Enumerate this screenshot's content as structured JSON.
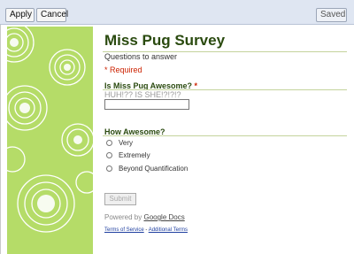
{
  "toolbar": {
    "apply_label": "Apply",
    "cancel_label": "Cancel",
    "saved_label": "Saved"
  },
  "form": {
    "title": "Miss Pug Survey",
    "subtitle": "Questions to answer",
    "required_note": "* Required",
    "questions": [
      {
        "title": "Is Miss Pug Awesome?",
        "required_mark": "*",
        "help_text": "HUH!?? IS SHE!?!?!?",
        "value": ""
      },
      {
        "title": "How Awesome?",
        "options": [
          "Very",
          "Extremely",
          "Beyond Quantification"
        ]
      }
    ],
    "submit_label": "Submit"
  },
  "footer": {
    "powered_prefix": "Powered by",
    "powered_link": "Google Docs",
    "terms_label": "Terms of Service",
    "separator": " - ",
    "additional_terms_label": "Additional Terms"
  },
  "theme": {
    "accent_green": "#b5dc68",
    "title_color": "#2a4a0f",
    "required_color": "#cc2200"
  }
}
